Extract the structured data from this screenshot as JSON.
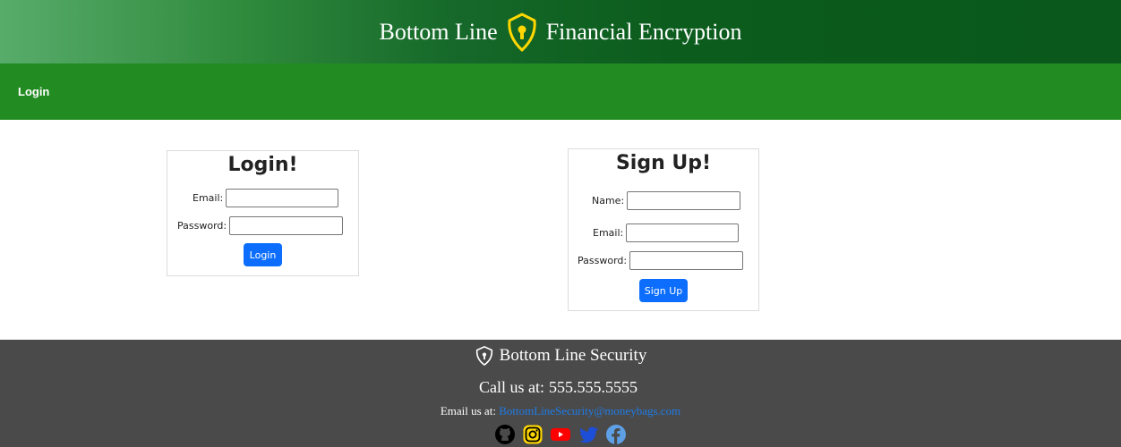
{
  "banner": {
    "title_left": "Bottom Line",
    "title_right": "Financial Encryption",
    "logo_icon": "keyhole-shield-icon"
  },
  "nav": {
    "login_label": "Login"
  },
  "login_card": {
    "title": "Login!",
    "email_label": "Email:",
    "email_value": "",
    "password_label": "Password:",
    "password_value": "",
    "button_label": "Login"
  },
  "signup_card": {
    "title": "Sign Up!",
    "name_label": "Name:",
    "name_value": "",
    "email_label": "Email:",
    "email_value": "",
    "password_label": "Password:",
    "password_value": "",
    "button_label": "Sign Up"
  },
  "footer": {
    "brand": "Bottom Line Security",
    "phone_prefix": "Call us at:",
    "phone": "555.555.5555",
    "email_prefix": "Email us at:",
    "email": "BottomLineSecurity@moneybags.com",
    "social_icons": [
      "github-icon",
      "instagram-icon",
      "youtube-icon",
      "twitter-icon",
      "facebook-icon"
    ]
  },
  "colors": {
    "nav_green": "#228b22",
    "banner_dark_green": "#0a581b",
    "button_blue": "#0d6efd",
    "footer_gray": "#4a4a4a",
    "logo_yellow": "#ffd700",
    "link_blue": "#1e7be6"
  }
}
